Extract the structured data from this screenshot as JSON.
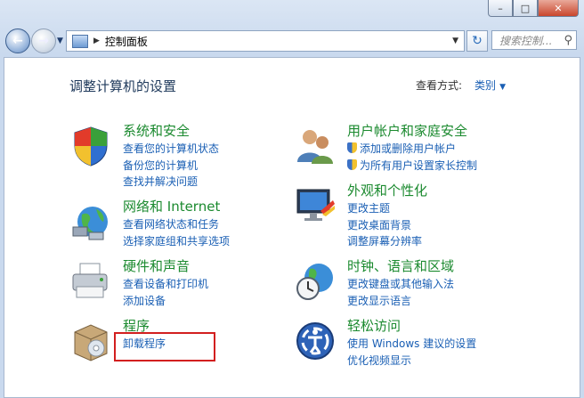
{
  "window": {
    "caption_buttons": [
      "–",
      "□",
      "✕"
    ],
    "breadcrumb": "控制面板",
    "search_placeholder": "搜索控制..."
  },
  "page": {
    "title": "调整计算机的设置",
    "view_by_label": "查看方式:",
    "view_by_value": "类别"
  },
  "categories": [
    {
      "name": "系统和安全",
      "icon": "shield-flag-icon",
      "links": [
        "查看您的计算机状态",
        "备份您的计算机",
        "查找并解决问题"
      ]
    },
    {
      "name": "网络和 Internet",
      "icon": "globe-network-icon",
      "links": [
        "查看网络状态和任务",
        "选择家庭组和共享选项"
      ]
    },
    {
      "name": "硬件和声音",
      "icon": "printer-icon",
      "links": [
        "查看设备和打印机",
        "添加设备"
      ]
    },
    {
      "name": "程序",
      "icon": "programs-box-icon",
      "links": [
        "卸载程序"
      ]
    },
    {
      "name": "用户帐户和家庭安全",
      "icon": "users-icon",
      "links": [
        "添加或删除用户帐户",
        "为所有用户设置家长控制"
      ]
    },
    {
      "name": "外观和个性化",
      "icon": "monitor-palette-icon",
      "links": [
        "更改主题",
        "更改桌面背景",
        "调整屏幕分辨率"
      ]
    },
    {
      "name": "时钟、语言和区域",
      "icon": "globe-clock-icon",
      "links": [
        "更改键盘或其他输入法",
        "更改显示语言"
      ]
    },
    {
      "name": "轻松访问",
      "icon": "ease-of-access-icon",
      "links": [
        "使用 Windows 建议的设置",
        "优化视频显示"
      ]
    }
  ],
  "colors": {
    "category_heading": "#1b8a2f",
    "link": "#1a5fb4",
    "highlight_box": "#d21f1f"
  }
}
